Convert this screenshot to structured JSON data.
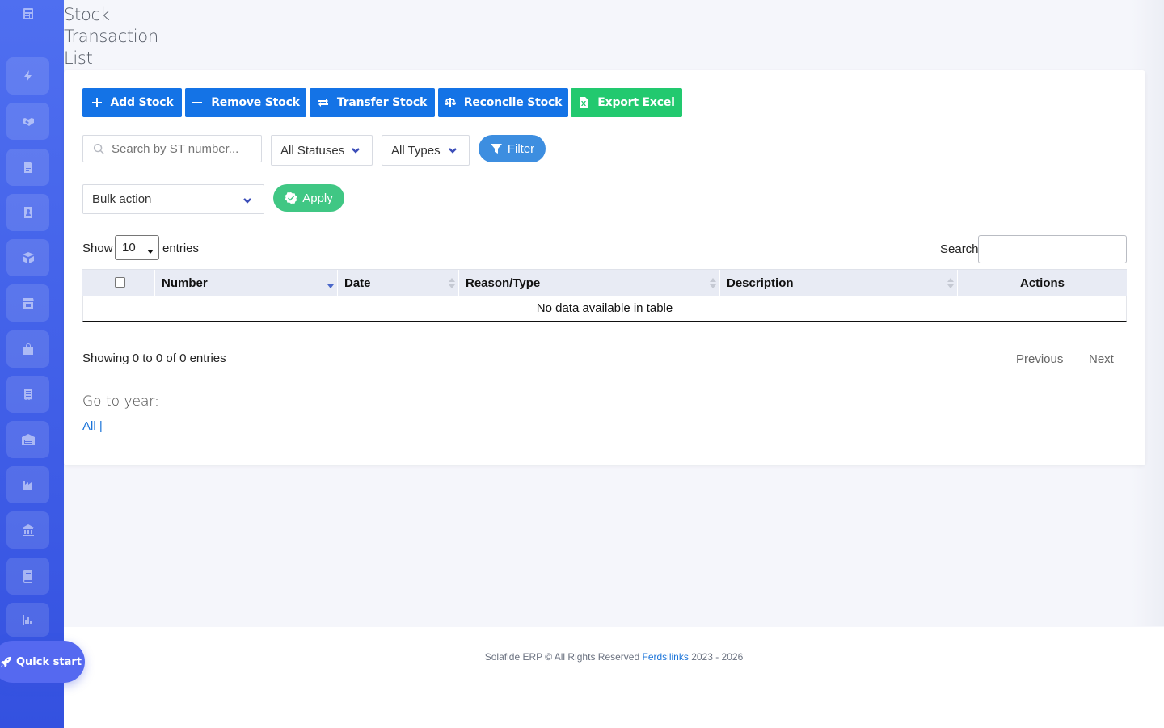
{
  "page": {
    "title": "Stock Transaction List"
  },
  "toolbar": {
    "add_stock": "Add Stock",
    "remove_stock": "Remove Stock",
    "transfer_stock": "Transfer Stock",
    "reconcile_stock": "Reconcile Stock",
    "export_excel": "Export Excel"
  },
  "filters": {
    "search_placeholder": "Search by ST number...",
    "status_value": "All Statuses",
    "type_value": "All Types",
    "filter_label": "Filter"
  },
  "bulk": {
    "value": "Bulk action",
    "apply_label": "Apply"
  },
  "table": {
    "show_label": "Show",
    "page_length": "10",
    "entries_label": "entries",
    "search_label": "Search",
    "columns": [
      "Number",
      "Date",
      "Reason/Type",
      "Description",
      "Actions"
    ],
    "empty_message": "No data available in table",
    "info": "Showing 0 to 0 of 0 entries",
    "previous": "Previous",
    "next": "Next"
  },
  "year_nav": {
    "label": "Go to year:",
    "all_link": "All |"
  },
  "footer": {
    "text_before": "Solafide ERP © All Rights Reserved",
    "link": "Ferdsilinks",
    "text_after": "2023 - 2026"
  },
  "quick_start": {
    "label": "Quick start"
  },
  "sidebar": {
    "icons": [
      "calculator-icon",
      "bolt-icon",
      "handshake-icon",
      "document-icon",
      "contact-book-icon",
      "box-icon",
      "store-icon",
      "shopping-bag-icon",
      "receipt-icon",
      "warehouse-icon",
      "factory-icon",
      "bank-icon",
      "book-icon",
      "chart-icon"
    ]
  },
  "colors": {
    "primary": "#1473e6",
    "success": "#22c96f",
    "sidebar": "#3f5ee8"
  }
}
